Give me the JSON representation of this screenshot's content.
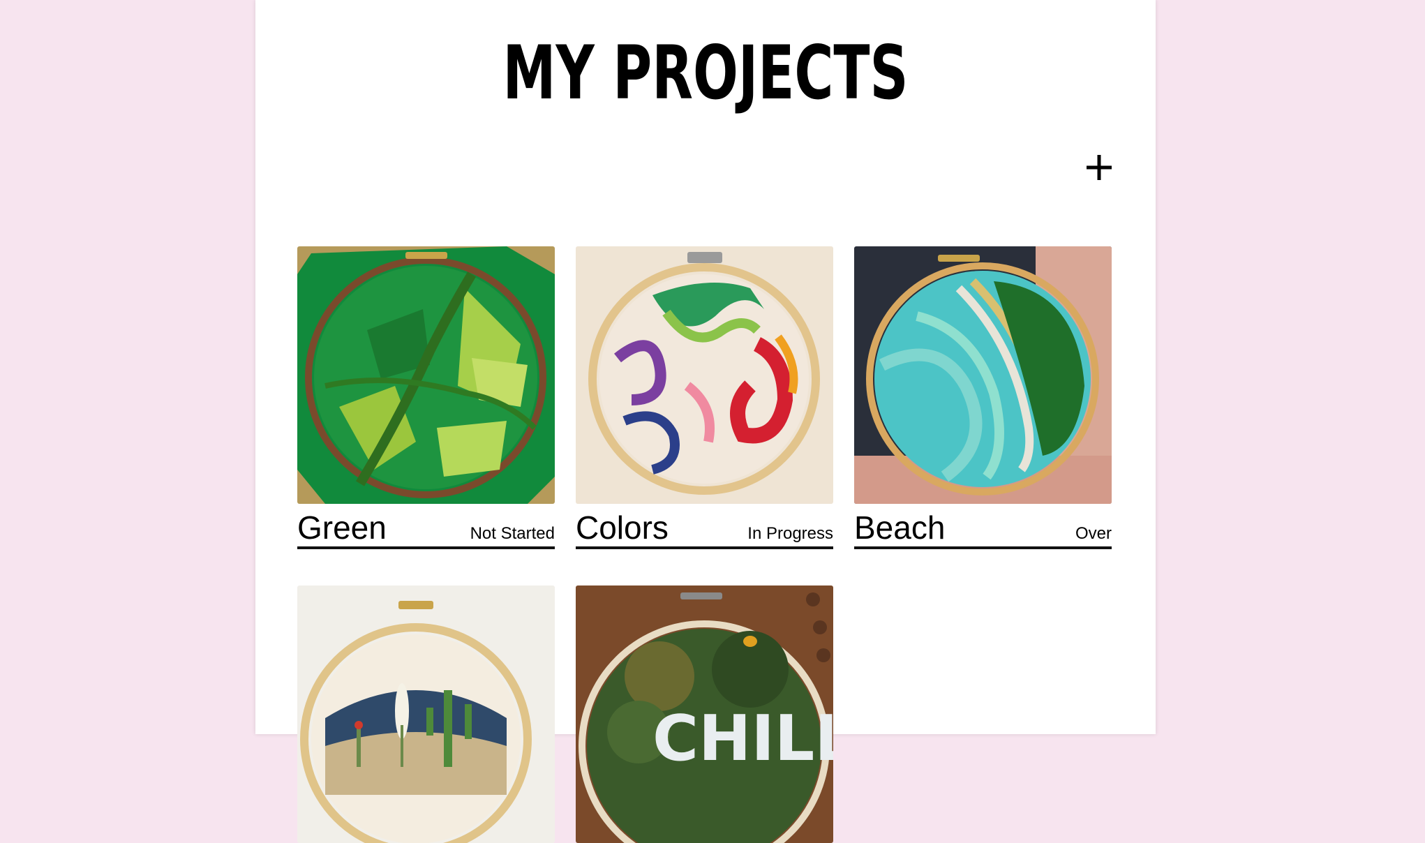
{
  "header": {
    "title": "MY PROJECTS",
    "add_icon": "plus-icon"
  },
  "projects": [
    {
      "name": "Green",
      "status": "Not Started",
      "image": "green-landscape-embroidery-hoop"
    },
    {
      "name": "Colors",
      "status": "In Progress",
      "image": "rainbow-wave-embroidery-hoop"
    },
    {
      "name": "Beach",
      "status": "Over",
      "image": "beach-coast-embroidery-hoop"
    },
    {
      "name": "",
      "status": "",
      "image": "desert-cactus-embroidery-hoop"
    },
    {
      "name": "",
      "status": "",
      "image": "chill-tufted-embroidery-hoop"
    }
  ],
  "colors": {
    "background": "#f7e4ef",
    "panel": "#ffffff",
    "text": "#000000"
  }
}
